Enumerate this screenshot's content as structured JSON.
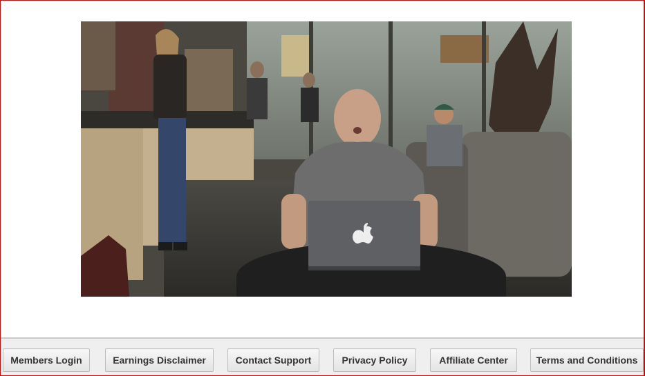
{
  "video": {
    "icon": "apple-logo-icon"
  },
  "footer": {
    "links": [
      {
        "label": "Members Login"
      },
      {
        "label": "Earnings Disclaimer"
      },
      {
        "label": "Contact Support"
      },
      {
        "label": "Privacy Policy"
      },
      {
        "label": "Affiliate Center"
      },
      {
        "label": "Terms and Conditions"
      }
    ]
  },
  "colors": {
    "frame_border": "#e00000",
    "footer_bg": "#efefef",
    "button_text": "#333333"
  }
}
